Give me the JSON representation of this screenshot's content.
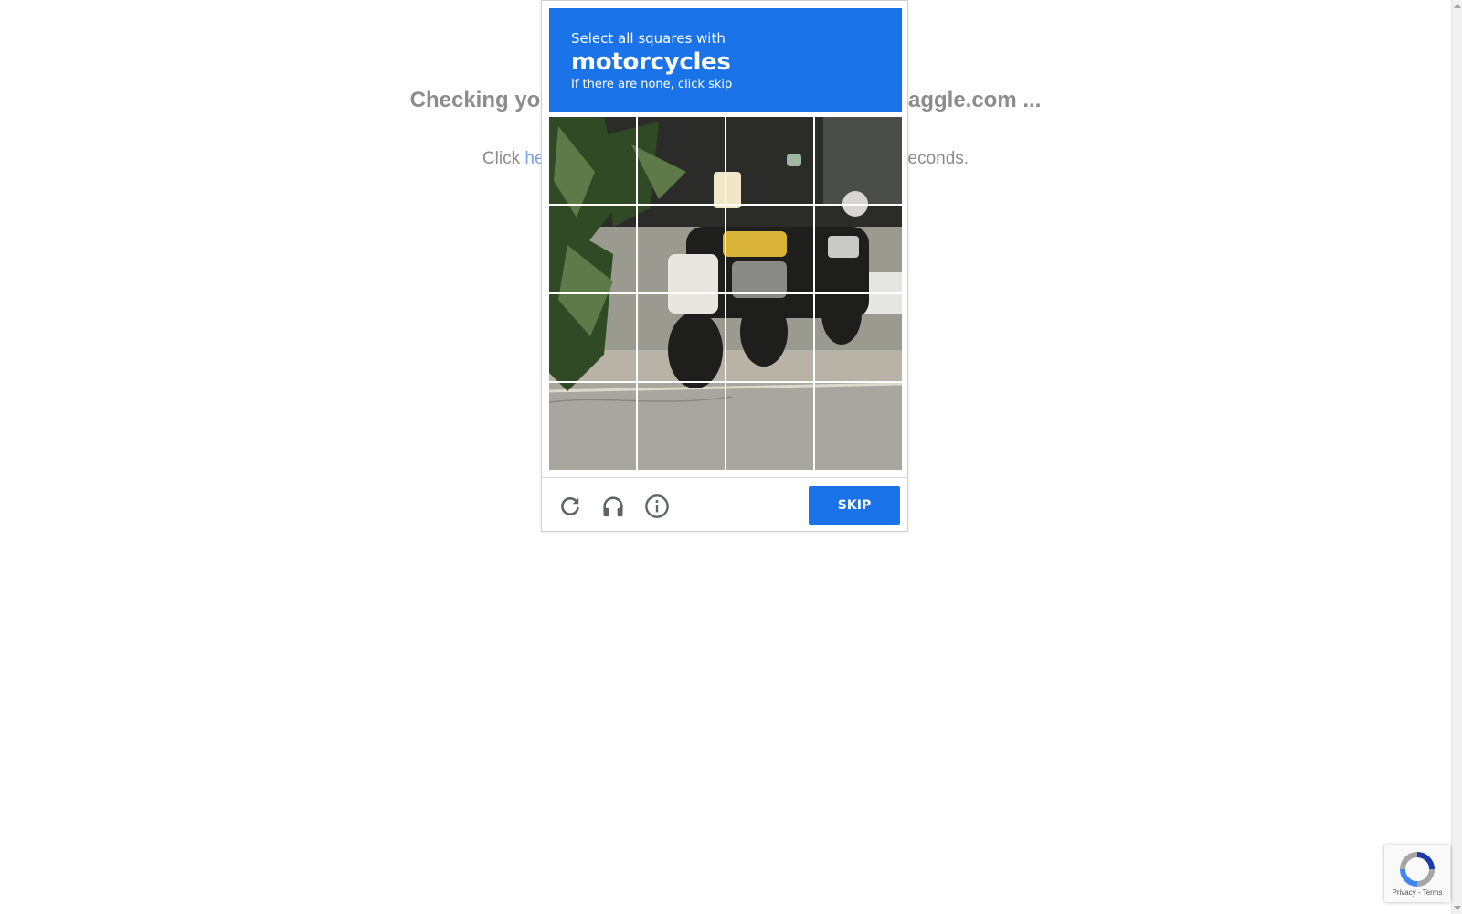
{
  "page": {
    "heading": "Checking you",
    "heading_end": "aggle.com ...",
    "sub_prefix": "Click ",
    "sub_link": "he",
    "sub_suffix": "econds."
  },
  "captcha": {
    "instruction": "Select all squares with",
    "target": "motorcycles",
    "hint": "If there are none, click skip",
    "grid": {
      "rows": 4,
      "columns": 4
    },
    "skip_label": "SKIP",
    "icons": [
      "reload-icon",
      "audio-challenge-icon",
      "info-icon"
    ],
    "accent_color": "#1a73e8"
  },
  "badge": {
    "privacy": "Privacy",
    "separator": " - ",
    "terms": "Terms"
  }
}
